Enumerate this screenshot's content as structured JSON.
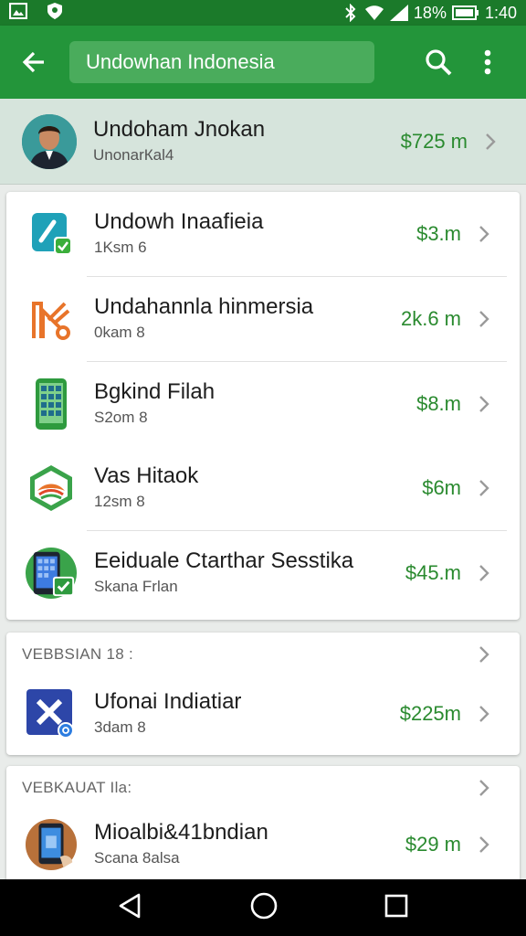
{
  "status_bar": {
    "battery_percent": "18%",
    "time": "1:40"
  },
  "app_bar": {
    "search_text": "Undowhan Indonesia"
  },
  "profile": {
    "name": "Undoham Jnokan",
    "subtitle": "UnonarКal4",
    "value": "$725 m"
  },
  "list_main": [
    {
      "title": "Undowh Inaafieia",
      "subtitle": "1Ksm 6",
      "value": "$3.m",
      "icon": "phone-check-icon"
    },
    {
      "title": "Undahannla hinmersia",
      "subtitle": "0kam 8",
      "value": "2k.6 m",
      "icon": "orange-logo-icon"
    },
    {
      "title": "Bgkind Filah",
      "subtitle": "S2om 8",
      "value": "$8.m",
      "icon": "calculator-phone-icon"
    },
    {
      "title": "Vas Hitaok",
      "subtitle": "12sm 8",
      "value": "$6m",
      "icon": "green-emblem-icon"
    },
    {
      "title": "Eeiduale Ctarthar Sesstika",
      "subtitle": "Skana Frlan",
      "value": "$45.m",
      "icon": "tablet-check-icon"
    }
  ],
  "section_one": {
    "header": "VEBBSIAN 18 :",
    "items": [
      {
        "title": "Ufonai Indiatiar",
        "subtitle": "3dam 8",
        "value": "$225m",
        "icon": "x-app-icon"
      }
    ]
  },
  "section_two": {
    "header": "VEBKAUAT Ila:",
    "items": [
      {
        "title": "Mioalbi&41bndian",
        "subtitle": "Scana 8alsa",
        "value": "$29 m",
        "icon": "phone-photo-icon"
      }
    ]
  },
  "colors": {
    "status_bar": "#1b7a2a",
    "app_bar": "#23953a",
    "accent_value": "#2a8a2f"
  }
}
